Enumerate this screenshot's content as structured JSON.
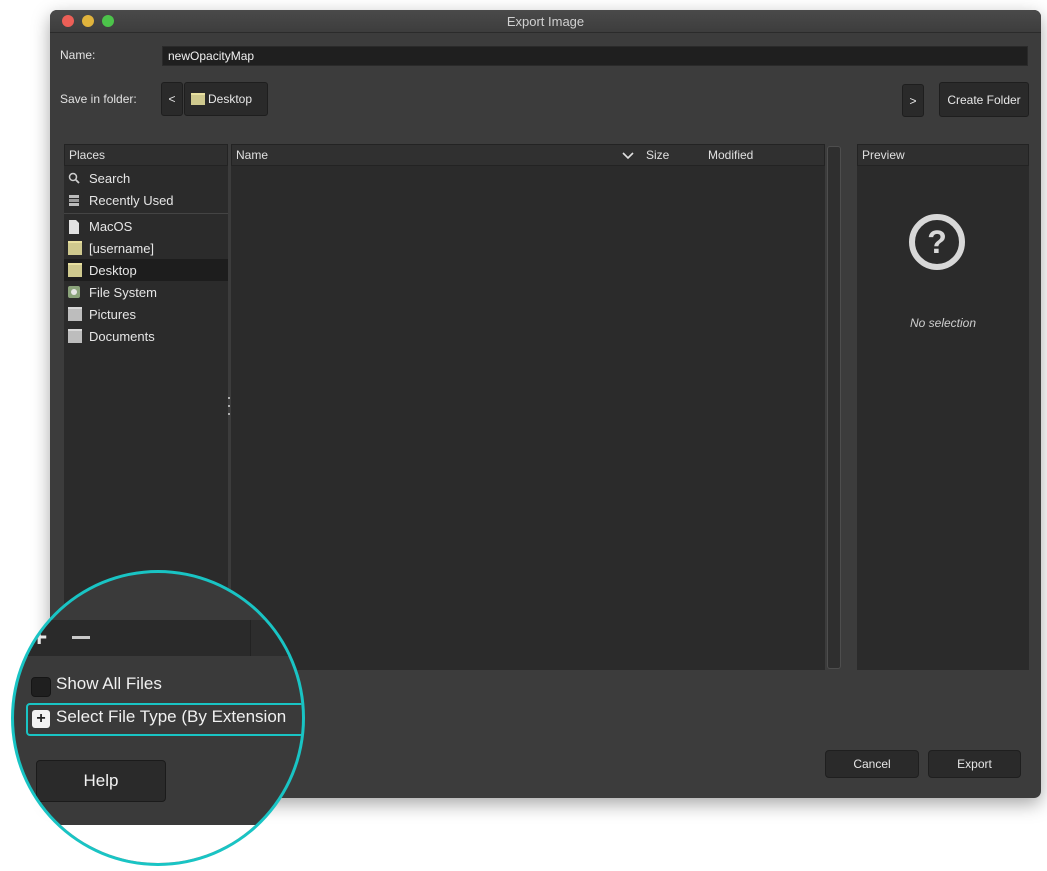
{
  "window": {
    "title": "Export Image"
  },
  "name_row": {
    "label": "Name:",
    "value": "newOpacityMap"
  },
  "folder_row": {
    "label": "Save in folder:",
    "back_glyph": "<",
    "forward_glyph": ">",
    "current_folder": "Desktop",
    "create_folder_label": "Create Folder"
  },
  "places": {
    "header": "Places",
    "items": [
      {
        "label": "Search",
        "icon": "search-icon"
      },
      {
        "label": "Recently Used",
        "icon": "recent-icon"
      },
      {
        "label": "MacOS",
        "icon": "drive-icon"
      },
      {
        "label": "[username]",
        "icon": "home-folder-icon"
      },
      {
        "label": "Desktop",
        "icon": "folder-icon",
        "selected": true
      },
      {
        "label": "File System",
        "icon": "filesystem-icon"
      },
      {
        "label": "Pictures",
        "icon": "folder-icon"
      },
      {
        "label": "Documents",
        "icon": "folder-icon"
      }
    ]
  },
  "file_list": {
    "columns": [
      "Name",
      "Size",
      "Modified"
    ]
  },
  "preview": {
    "header": "Preview",
    "empty_text": "No selection"
  },
  "footer": {
    "show_all_files_label": "Show All Files",
    "select_file_type_label": "Select File Type (By Extension",
    "help_label": "Help",
    "cancel_label": "Cancel",
    "export_label": "Export"
  },
  "colors": {
    "highlight_ring": "#19c4c4",
    "window_bg": "#3c3c3c"
  }
}
